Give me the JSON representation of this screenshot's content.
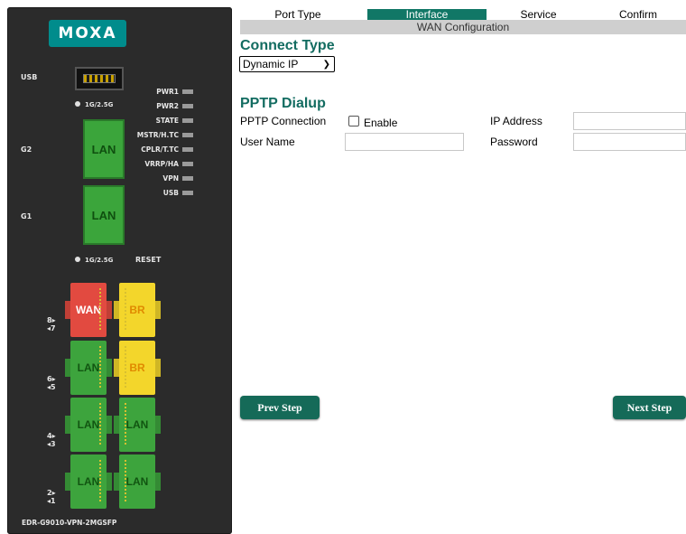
{
  "device": {
    "logo": "MOXA",
    "usb_label": "USB",
    "speed_label_top": "1G/2.5G",
    "speed_label_bottom": "1G/2.5G",
    "reset_label": "RESET",
    "g2_label": "G2",
    "g1_label": "G1",
    "g2_port": "LAN",
    "g1_port": "LAN",
    "leds": [
      "PWR1",
      "PWR2",
      "STATE",
      "MSTR/H.TC",
      "CPLR/T.TC",
      "VRRP/HA",
      "VPN",
      "USB"
    ],
    "ports": [
      {
        "left": "WAN",
        "right": "BR",
        "num_top": "8▸",
        "num_bottom": "◂7"
      },
      {
        "left": "LAN",
        "right": "BR",
        "num_top": "6▸",
        "num_bottom": "◂5"
      },
      {
        "left": "LAN",
        "right": "LAN",
        "num_top": "4▸",
        "num_bottom": "◂3"
      },
      {
        "left": "LAN",
        "right": "LAN",
        "num_top": "2▸",
        "num_bottom": "◂1"
      }
    ],
    "model": "EDR-G9010-VPN-2MGSFP"
  },
  "wizard": {
    "steps": [
      "Port Type",
      "Interface",
      "Service",
      "Confirm"
    ],
    "active_step": "Interface",
    "bar_title": "WAN Configuration"
  },
  "connect_type": {
    "title": "Connect Type",
    "selected": "Dynamic IP"
  },
  "pptp": {
    "title": "PPTP Dialup",
    "connection_label": "PPTP Connection",
    "enable_label": "Enable",
    "enabled": false,
    "ip_label": "IP Address",
    "ip_value": "",
    "user_label": "User Name",
    "user_value": "",
    "password_label": "Password",
    "password_value": ""
  },
  "buttons": {
    "prev": "Prev Step",
    "next": "Next Step"
  },
  "colors": {
    "accent": "#117766",
    "heading": "#136c61",
    "button": "#156a58"
  }
}
